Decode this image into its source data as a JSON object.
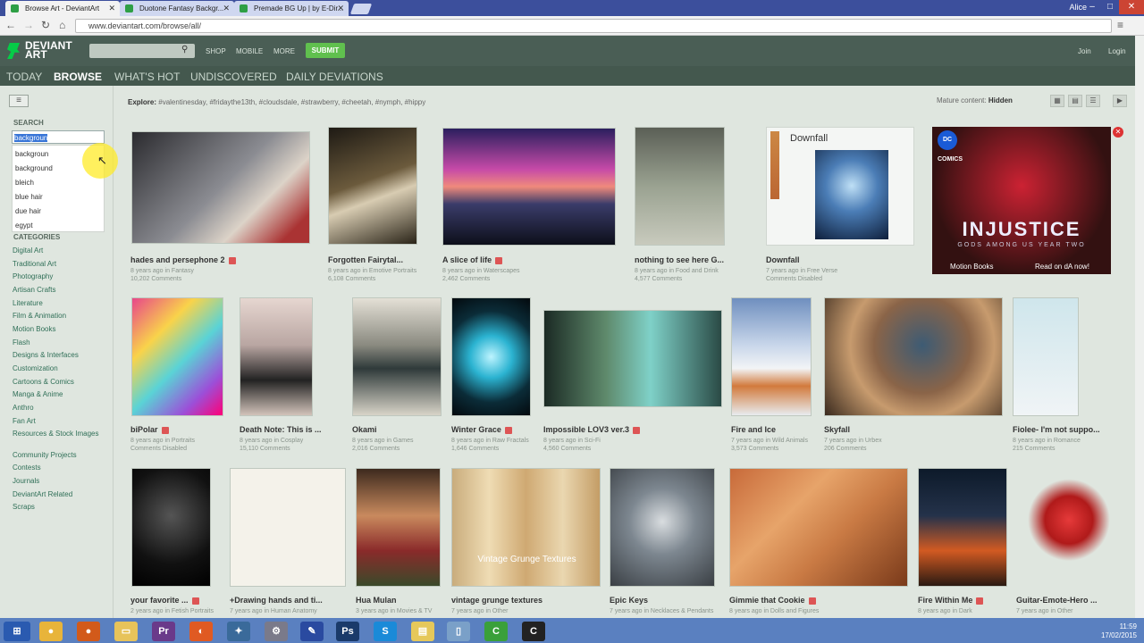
{
  "browser": {
    "tabs": [
      {
        "title": "Browse Art - DeviantArt",
        "active": true
      },
      {
        "title": "Duotone Fantasy Backgr...",
        "active": false
      },
      {
        "title": "Premade BG Up | by E-Dir...",
        "active": false
      }
    ],
    "user": "Alice",
    "url": "www.deviantart.com/browse/all/"
  },
  "header": {
    "logo_line1": "DEVIANT",
    "logo_line2": "ART",
    "links": [
      "SHOP",
      "MOBILE",
      "MORE"
    ],
    "submit": "SUBMIT",
    "join": "Join",
    "login": "Login"
  },
  "nav": [
    "TODAY",
    "BROWSE",
    "WHAT'S HOT",
    "UNDISCOVERED",
    "DAILY DEVIATIONS"
  ],
  "sidebar": {
    "search_heading": "SEARCH",
    "search_value": "backgroun",
    "suggestions": [
      "backgroun",
      "background",
      "bleich",
      "blue hair",
      "due hair",
      "egypt"
    ],
    "categories_heading": "CATEGORIES",
    "categories": [
      "Digital Art",
      "Traditional Art",
      "Photography",
      "Artisan Crafts",
      "Literature",
      "Film & Animation",
      "Motion Books",
      "Flash",
      "Designs & Interfaces",
      "Customization",
      "Cartoons & Comics",
      "Manga & Anime",
      "Anthro",
      "Fan Art",
      "Resources & Stock Images",
      "Community Projects",
      "Contests",
      "Journals",
      "DeviantArt Related",
      "Scraps"
    ]
  },
  "explore": {
    "label": "Explore:",
    "tags": "#valentinesday, #fridaythe13th, #cloudsdale, #strawberry, #cheetah, #nymph, #hippy"
  },
  "mature": {
    "label": "Mature content:",
    "value": "Hidden"
  },
  "row1": [
    {
      "title": "hades and persephone 2",
      "meta": "8 years ago in Fantasy",
      "comments": "10,202 Comments"
    },
    {
      "title": "Forgotten Fairytal...",
      "meta": "8 years ago in Emotive Portraits",
      "comments": "6,108 Comments"
    },
    {
      "title": "A slice of life",
      "meta": "8 years ago in Waterscapes",
      "comments": "2,462 Comments"
    },
    {
      "title": "nothing to see here G...",
      "meta": "8 years ago in Food and Drink",
      "comments": "4,577 Comments"
    },
    {
      "title": "Downfall",
      "meta": "7 years ago in Free Verse",
      "comments": "Comments Disabled"
    }
  ],
  "downfall_card_title": "Downfall",
  "ad": {
    "badge": "DC COMICS",
    "title": "INJUSTICE",
    "subtitle": "GODS AMONG US YEAR TWO",
    "left": "Motion Books",
    "right": "Read on dA now!"
  },
  "row2": [
    {
      "title": "biPolar",
      "meta": "8 years ago in Portraits",
      "comments": "Comments Disabled"
    },
    {
      "title": "Death Note: This is ...",
      "meta": "8 years ago in Cosplay",
      "comments": "15,110 Comments"
    },
    {
      "title": "Okami",
      "meta": "8 years ago in Games",
      "comments": "2,016 Comments"
    },
    {
      "title": "Winter Grace",
      "meta": "8 years ago in Raw Fractals",
      "comments": "1,646 Comments"
    },
    {
      "title": "Impossible LOV3 ver.3",
      "meta": "8 years ago in Sci-Fi",
      "comments": "4,560 Comments"
    },
    {
      "title": "Fire and Ice",
      "meta": "7 years ago in Wild Animals",
      "comments": "3,573 Comments"
    },
    {
      "title": "Skyfall",
      "meta": "7 years ago in Urbex",
      "comments": "206 Comments"
    },
    {
      "title": "Fiolee- I'm not suppo...",
      "meta": "8 years ago in Romance",
      "comments": "215 Comments"
    }
  ],
  "row3": [
    {
      "title": "your favorite ...",
      "meta": "2 years ago in Fetish Portraits"
    },
    {
      "title": "+Drawing hands and ti...",
      "meta": "7 years ago in Human Anatomy"
    },
    {
      "title": "Hua Mulan",
      "meta": "3 years ago in Movies & TV"
    },
    {
      "title": "vintage grunge textures",
      "meta": "7 years ago in Other"
    },
    {
      "title": "Epic Keys",
      "meta": "7 years ago in Necklaces & Pendants"
    },
    {
      "title": "Gimmie that Cookie",
      "meta": "8 years ago in Dolls and Figures"
    },
    {
      "title": "Fire Within Me",
      "meta": "8 years ago in Dark"
    },
    {
      "title": "Guitar-Emote-Hero ...",
      "meta": "7 years ago in Other"
    }
  ],
  "vintage_overlay": "Vintage Grunge Textures",
  "clock": {
    "time": "11:59",
    "date": "17/02/2015"
  }
}
